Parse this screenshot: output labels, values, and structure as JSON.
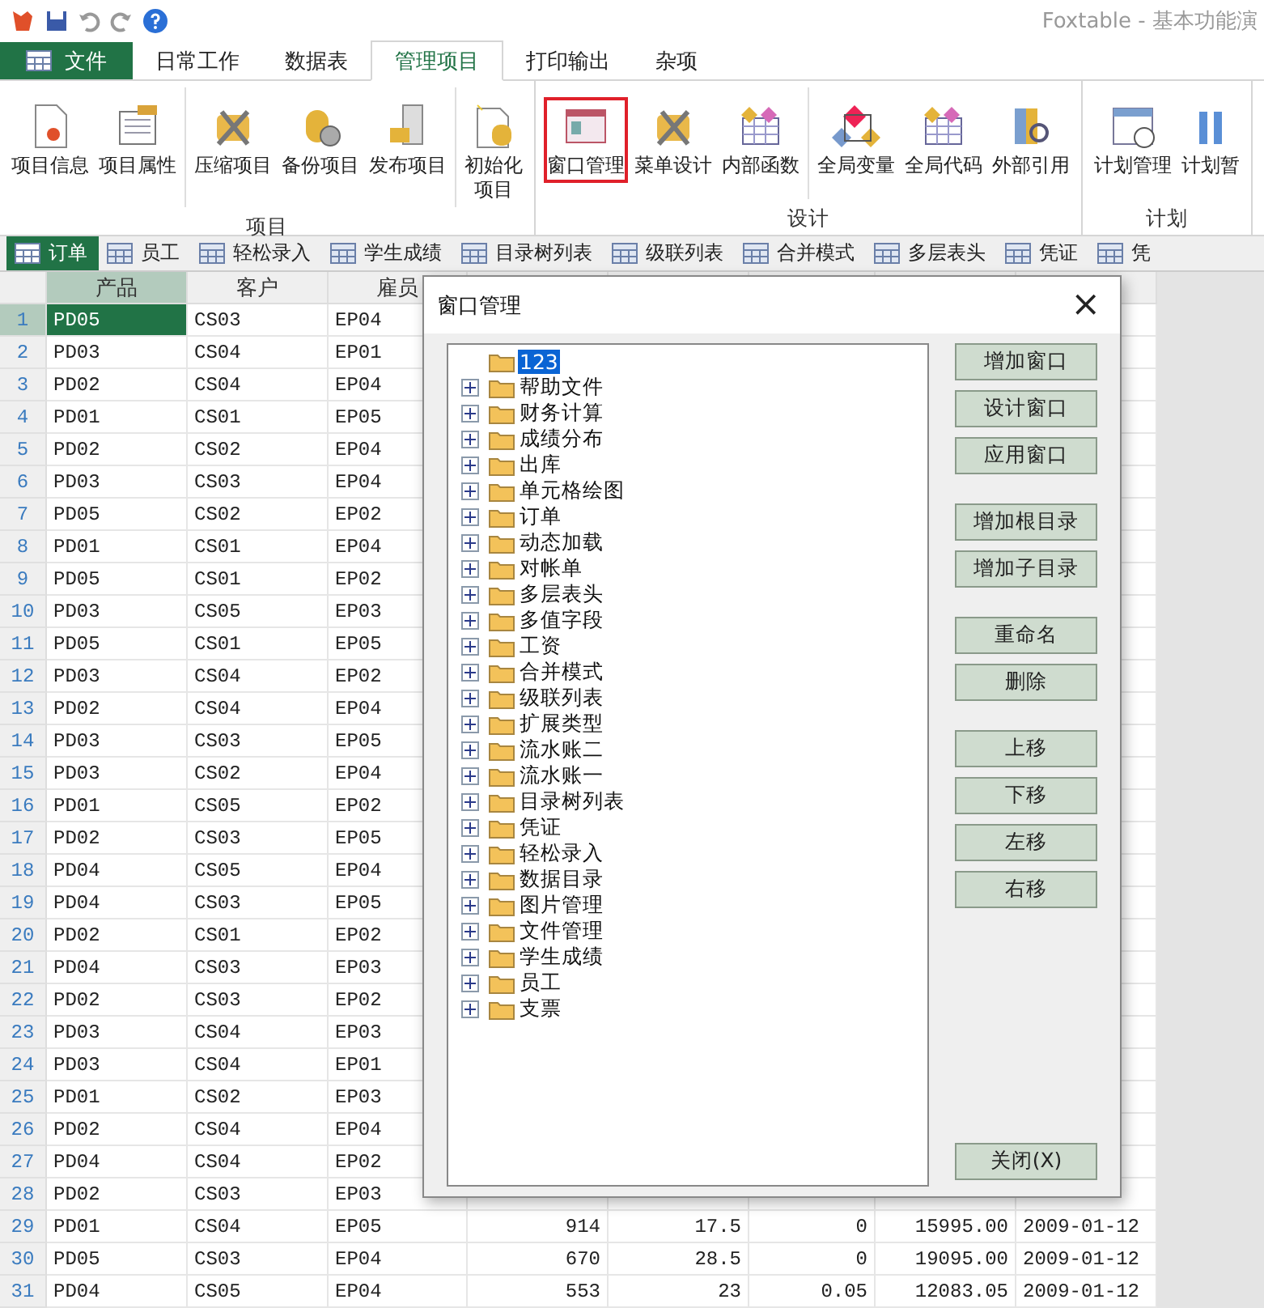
{
  "window": {
    "title": "Foxtable - 基本功能演"
  },
  "menu_tabs": [
    {
      "label": "文件",
      "kind": "file",
      "selected": false
    },
    {
      "label": "日常工作",
      "kind": "tab",
      "selected": false
    },
    {
      "label": "数据表",
      "kind": "tab",
      "selected": false
    },
    {
      "label": "管理项目",
      "kind": "tab",
      "selected": true
    },
    {
      "label": "打印输出",
      "kind": "tab",
      "selected": false
    },
    {
      "label": "杂项",
      "kind": "tab",
      "selected": false
    }
  ],
  "ribbon": [
    {
      "label": "项目",
      "sections": [
        [
          {
            "label": "项目信息",
            "highlighted": false
          },
          {
            "label": "项目属性",
            "highlighted": false
          }
        ],
        [
          {
            "label": "压缩项目",
            "highlighted": false
          },
          {
            "label": "备份项目",
            "highlighted": false
          },
          {
            "label": "发布项目",
            "highlighted": false
          }
        ],
        [
          {
            "label": "初始化项目",
            "highlighted": false
          }
        ]
      ]
    },
    {
      "label": "设计",
      "sections": [
        [
          {
            "label": "窗口管理",
            "highlighted": true
          },
          {
            "label": "菜单设计",
            "highlighted": false
          },
          {
            "label": "内部函数",
            "highlighted": false
          }
        ],
        [
          {
            "label": "全局变量",
            "highlighted": false
          },
          {
            "label": "全局代码",
            "highlighted": false
          },
          {
            "label": "外部引用",
            "highlighted": false
          }
        ]
      ]
    },
    {
      "label": "计划",
      "sections": [
        [
          {
            "label": "计划管理",
            "highlighted": false
          },
          {
            "label": "计划暂",
            "highlighted": false
          }
        ]
      ]
    }
  ],
  "table_tabs": [
    {
      "label": "订单",
      "selected": true
    },
    {
      "label": "员工",
      "selected": false
    },
    {
      "label": "轻松录入",
      "selected": false
    },
    {
      "label": "学生成绩",
      "selected": false
    },
    {
      "label": "目录树列表",
      "selected": false
    },
    {
      "label": "级联列表",
      "selected": false
    },
    {
      "label": "合并模式",
      "selected": false
    },
    {
      "label": "多层表头",
      "selected": false
    },
    {
      "label": "凭证",
      "selected": false
    },
    {
      "label": "凭",
      "selected": false
    }
  ],
  "table": {
    "columns": [
      {
        "label": "产品",
        "selected": true
      },
      {
        "label": "客户",
        "selected": false
      },
      {
        "label": "雇员",
        "selected": false
      }
    ],
    "rows": [
      {
        "number": "1",
        "selected": true,
        "cells": [
          "PD05",
          "CS03",
          "EP04"
        ]
      },
      {
        "number": "2",
        "selected": false,
        "cells": [
          "PD03",
          "CS04",
          "EP01"
        ]
      },
      {
        "number": "3",
        "selected": false,
        "cells": [
          "PD02",
          "CS04",
          "EP04"
        ]
      },
      {
        "number": "4",
        "selected": false,
        "cells": [
          "PD01",
          "CS01",
          "EP05"
        ]
      },
      {
        "number": "5",
        "selected": false,
        "cells": [
          "PD02",
          "CS02",
          "EP04"
        ]
      },
      {
        "number": "6",
        "selected": false,
        "cells": [
          "PD03",
          "CS03",
          "EP04"
        ]
      },
      {
        "number": "7",
        "selected": false,
        "cells": [
          "PD05",
          "CS02",
          "EP02"
        ]
      },
      {
        "number": "8",
        "selected": false,
        "cells": [
          "PD01",
          "CS01",
          "EP04"
        ]
      },
      {
        "number": "9",
        "selected": false,
        "cells": [
          "PD05",
          "CS01",
          "EP02"
        ]
      },
      {
        "number": "10",
        "selected": false,
        "cells": [
          "PD03",
          "CS05",
          "EP03"
        ]
      },
      {
        "number": "11",
        "selected": false,
        "cells": [
          "PD05",
          "CS01",
          "EP05"
        ]
      },
      {
        "number": "12",
        "selected": false,
        "cells": [
          "PD03",
          "CS04",
          "EP02"
        ]
      },
      {
        "number": "13",
        "selected": false,
        "cells": [
          "PD02",
          "CS04",
          "EP04"
        ]
      },
      {
        "number": "14",
        "selected": false,
        "cells": [
          "PD03",
          "CS03",
          "EP05"
        ]
      },
      {
        "number": "15",
        "selected": false,
        "cells": [
          "PD03",
          "CS02",
          "EP04"
        ]
      },
      {
        "number": "16",
        "selected": false,
        "cells": [
          "PD01",
          "CS05",
          "EP02"
        ]
      },
      {
        "number": "17",
        "selected": false,
        "cells": [
          "PD02",
          "CS03",
          "EP05"
        ]
      },
      {
        "number": "18",
        "selected": false,
        "cells": [
          "PD04",
          "CS05",
          "EP04"
        ]
      },
      {
        "number": "19",
        "selected": false,
        "cells": [
          "PD04",
          "CS03",
          "EP05"
        ]
      },
      {
        "number": "20",
        "selected": false,
        "cells": [
          "PD02",
          "CS01",
          "EP02"
        ]
      },
      {
        "number": "21",
        "selected": false,
        "cells": [
          "PD04",
          "CS03",
          "EP03"
        ]
      },
      {
        "number": "22",
        "selected": false,
        "cells": [
          "PD02",
          "CS03",
          "EP02"
        ]
      },
      {
        "number": "23",
        "selected": false,
        "cells": [
          "PD03",
          "CS04",
          "EP03"
        ]
      },
      {
        "number": "24",
        "selected": false,
        "cells": [
          "PD03",
          "CS04",
          "EP01"
        ]
      },
      {
        "number": "25",
        "selected": false,
        "cells": [
          "PD01",
          "CS02",
          "EP03"
        ]
      },
      {
        "number": "26",
        "selected": false,
        "cells": [
          "PD02",
          "CS04",
          "EP04"
        ]
      },
      {
        "number": "27",
        "selected": false,
        "cells": [
          "PD04",
          "CS04",
          "EP02"
        ]
      },
      {
        "number": "28",
        "selected": false,
        "cells": [
          "PD02",
          "CS03",
          "EP03"
        ]
      },
      {
        "number": "29",
        "selected": false,
        "cells": [
          "PD01",
          "CS04",
          "EP05",
          "914",
          "17.5",
          "0",
          "15995.00",
          "2009-01-12"
        ]
      },
      {
        "number": "30",
        "selected": false,
        "cells": [
          "PD05",
          "CS03",
          "EP04",
          "670",
          "28.5",
          "0",
          "19095.00",
          "2009-01-12"
        ]
      },
      {
        "number": "31",
        "selected": false,
        "cells": [
          "PD04",
          "CS05",
          "EP04",
          "553",
          "23",
          "0.05",
          "12083.05",
          "2009-01-12"
        ]
      }
    ]
  },
  "dialog": {
    "title": "窗口管理",
    "close": "×",
    "tree": [
      {
        "label": "123",
        "has_children": false,
        "selected": true
      },
      {
        "label": "帮助文件",
        "has_children": true,
        "selected": false
      },
      {
        "label": "财务计算",
        "has_children": true,
        "selected": false
      },
      {
        "label": "成绩分布",
        "has_children": true,
        "selected": false
      },
      {
        "label": "出库",
        "has_children": true,
        "selected": false
      },
      {
        "label": "单元格绘图",
        "has_children": true,
        "selected": false
      },
      {
        "label": "订单",
        "has_children": true,
        "selected": false
      },
      {
        "label": "动态加载",
        "has_children": true,
        "selected": false
      },
      {
        "label": "对帐单",
        "has_children": true,
        "selected": false
      },
      {
        "label": "多层表头",
        "has_children": true,
        "selected": false
      },
      {
        "label": "多值字段",
        "has_children": true,
        "selected": false
      },
      {
        "label": "工资",
        "has_children": true,
        "selected": false
      },
      {
        "label": "合并模式",
        "has_children": true,
        "selected": false
      },
      {
        "label": "级联列表",
        "has_children": true,
        "selected": false
      },
      {
        "label": "扩展类型",
        "has_children": true,
        "selected": false
      },
      {
        "label": "流水账二",
        "has_children": true,
        "selected": false
      },
      {
        "label": "流水账一",
        "has_children": true,
        "selected": false
      },
      {
        "label": "目录树列表",
        "has_children": true,
        "selected": false
      },
      {
        "label": "凭证",
        "has_children": true,
        "selected": false
      },
      {
        "label": "轻松录入",
        "has_children": true,
        "selected": false
      },
      {
        "label": "数据目录",
        "has_children": true,
        "selected": false
      },
      {
        "label": "图片管理",
        "has_children": true,
        "selected": false
      },
      {
        "label": "文件管理",
        "has_children": true,
        "selected": false
      },
      {
        "label": "学生成绩",
        "has_children": true,
        "selected": false
      },
      {
        "label": "员工",
        "has_children": true,
        "selected": false
      },
      {
        "label": "支票",
        "has_children": true,
        "selected": false
      }
    ],
    "button_groups": [
      [
        "增加窗口",
        "设计窗口",
        "应用窗口"
      ],
      [
        "增加根目录",
        "增加子目录"
      ],
      [
        "重命名",
        "删除"
      ],
      [
        "上移",
        "下移",
        "左移",
        "右移"
      ]
    ],
    "close_button": "关闭(X)"
  }
}
